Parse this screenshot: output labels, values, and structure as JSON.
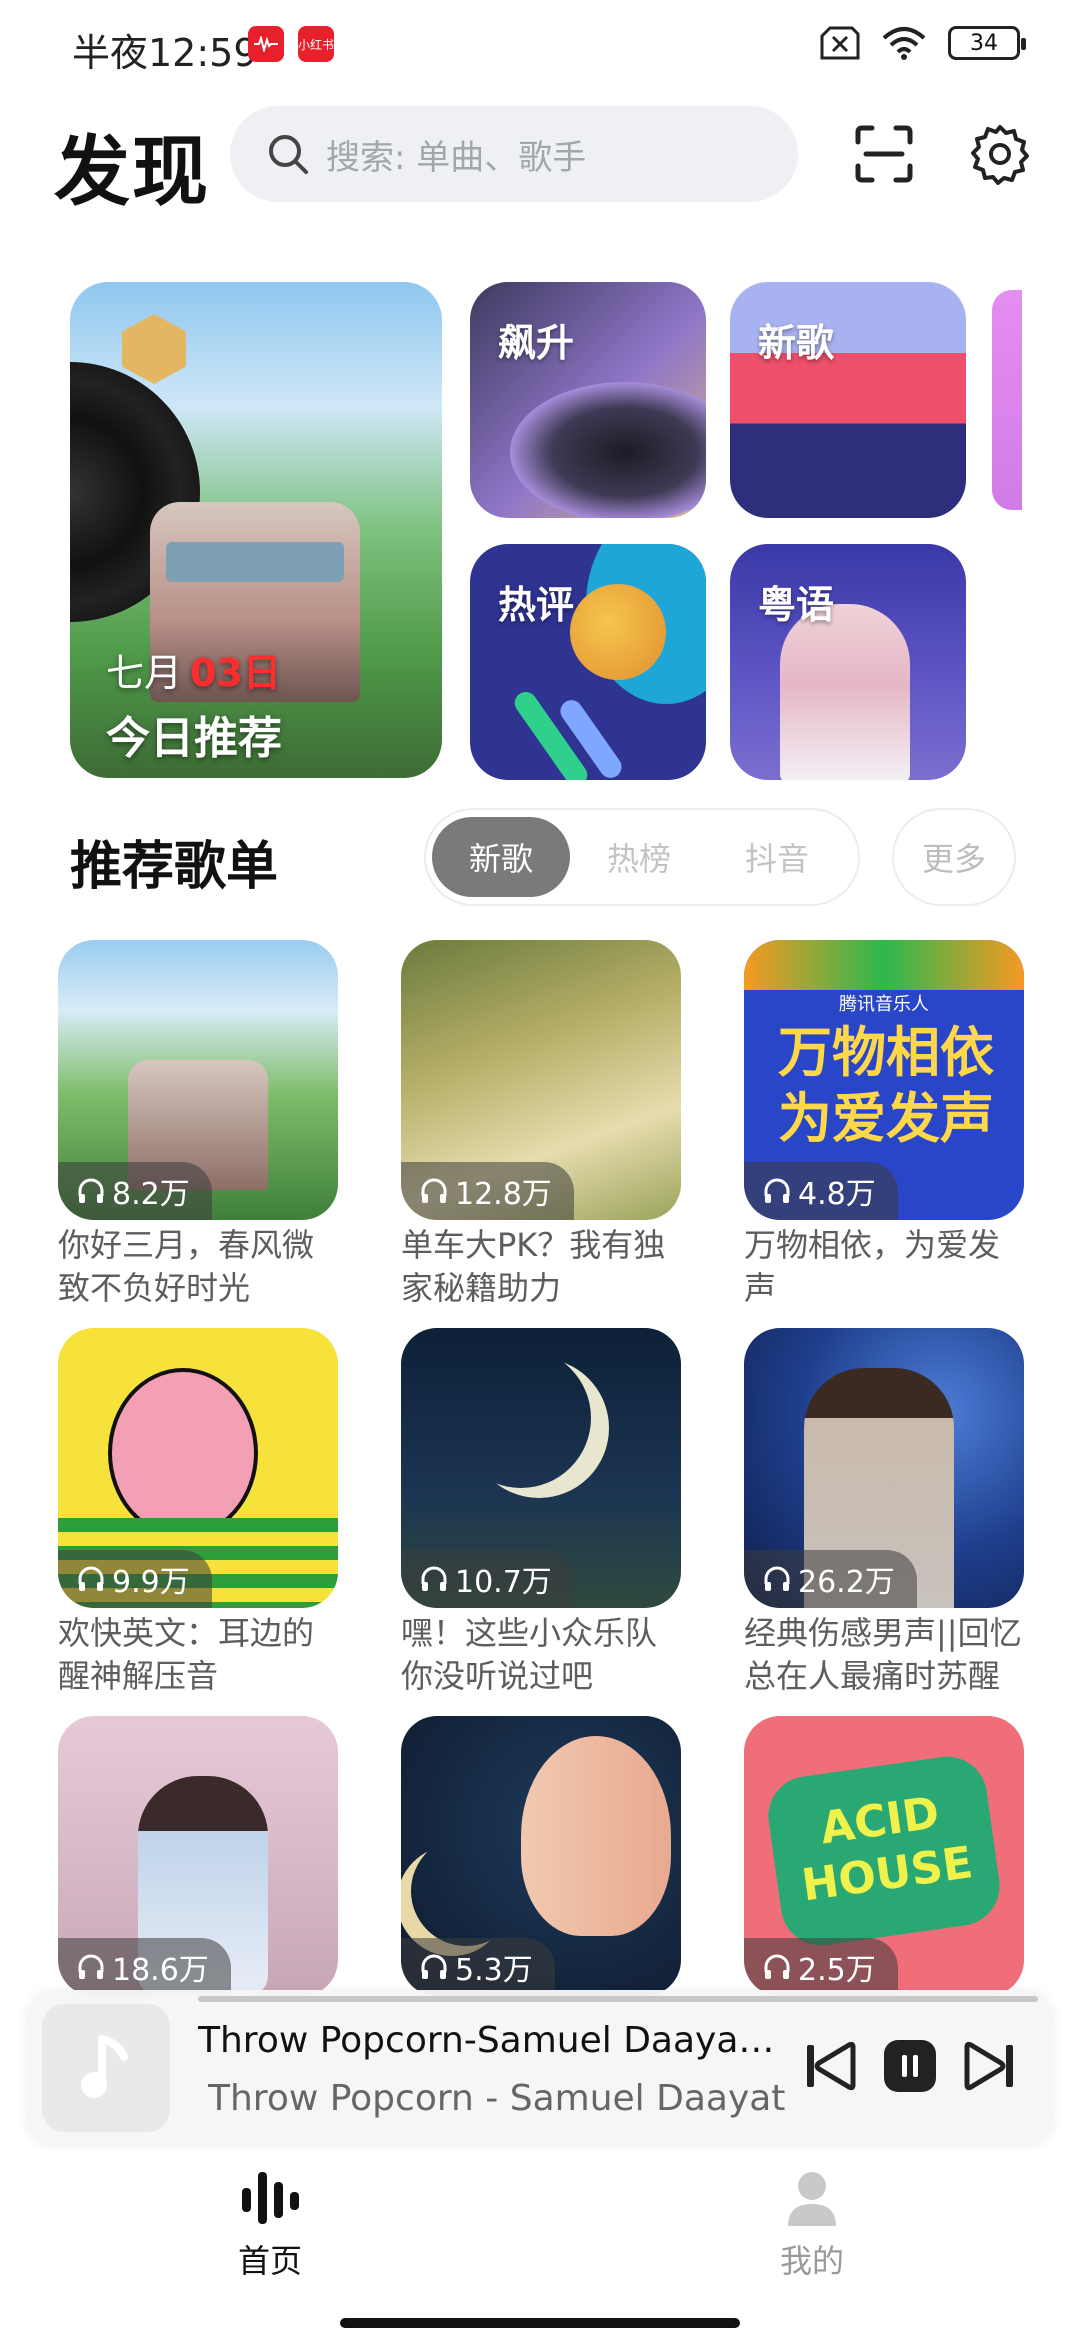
{
  "status_bar": {
    "time": "半夜12:59",
    "battery": "34",
    "badge_app_2": "小红书"
  },
  "header": {
    "title": "发现",
    "search_placeholder": "搜索: 单曲、歌手"
  },
  "banner": {
    "daily": {
      "month": "七月",
      "day": "03日",
      "label": "今日推荐"
    },
    "tiles": [
      {
        "label": "飙升"
      },
      {
        "label": "新歌"
      },
      {
        "label": "热评"
      },
      {
        "label": "粤语"
      }
    ]
  },
  "section": {
    "title": "推荐歌单",
    "tabs": [
      {
        "label": "新歌",
        "active": true
      },
      {
        "label": "热榜",
        "active": false
      },
      {
        "label": "抖音",
        "active": false
      }
    ],
    "more": "更多"
  },
  "playlists": [
    {
      "count": "8.2万",
      "title": "你好三月，春风微致不负好时光"
    },
    {
      "count": "12.8万",
      "title": "单车大PK？我有独家秘籍助力"
    },
    {
      "count": "4.8万",
      "title": "万物相依，为爱发声",
      "cover_text": "万物相依为爱发声",
      "cover_brand": "腾讯音乐人"
    },
    {
      "count": "9.9万",
      "title": "欢快英文：耳边的醒神解压音"
    },
    {
      "count": "10.7万",
      "title": "嘿！这些小众乐队你没听说过吧"
    },
    {
      "count": "26.2万",
      "title": "经典伤感男声||回忆总在人最痛时苏醒"
    },
    {
      "count": "18.6万",
      "title": ""
    },
    {
      "count": "5.3万",
      "title": ""
    },
    {
      "count": "2.5万",
      "title": "",
      "cover_text": "ACID HOUSE"
    }
  ],
  "player": {
    "title": "Throw Popcorn-Samuel Daayat...",
    "subtitle": "Throw Popcorn - Samuel Daayata"
  },
  "nav": {
    "home": "首页",
    "mine": "我的"
  },
  "colors": {
    "accent_red": "#e8202b",
    "seg_active": "#7a7a7a"
  }
}
